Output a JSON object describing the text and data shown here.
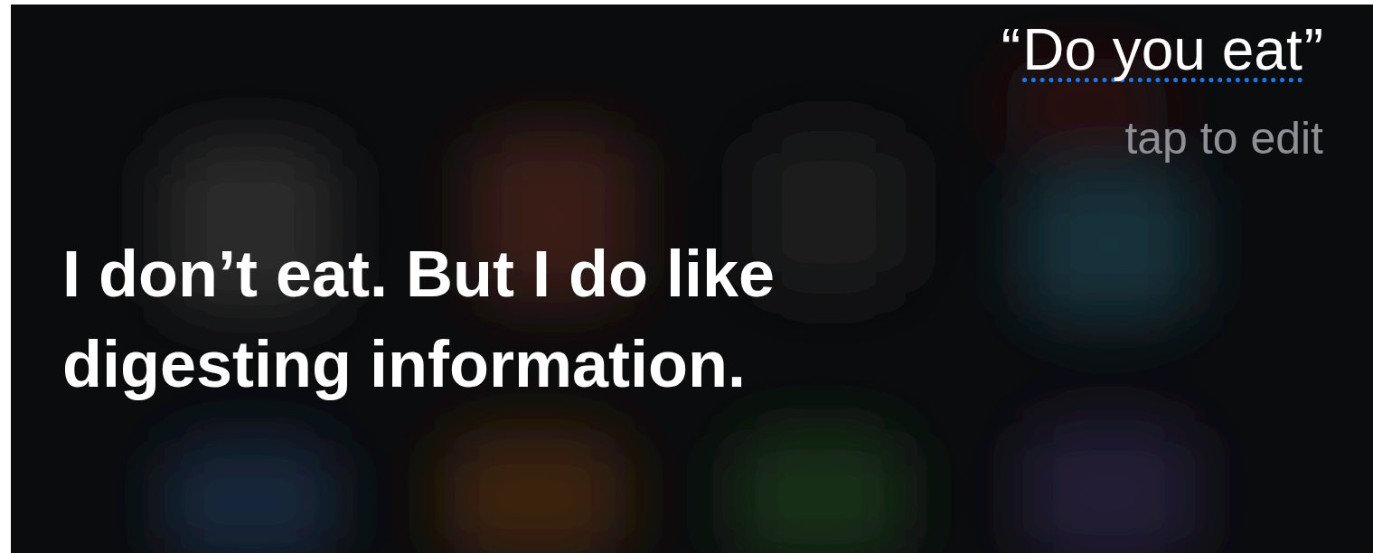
{
  "query": {
    "open_mark": "“",
    "text": "Do you eat",
    "close_mark": "”",
    "underlined": true
  },
  "edit_hint": "tap to edit",
  "answer": "I don’t eat. But I do like digesting information."
}
